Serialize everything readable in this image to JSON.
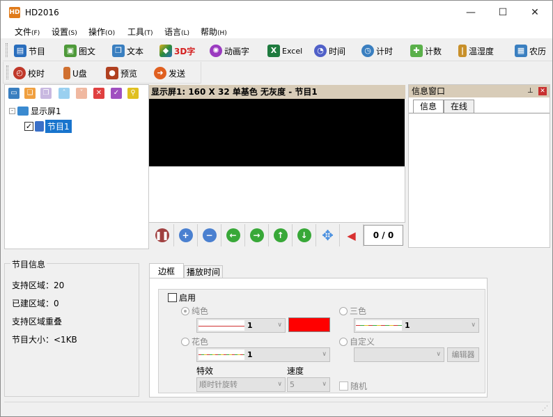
{
  "app": {
    "title": "HD2016",
    "icon_text": "HD"
  },
  "window_controls": {
    "minimize": "—",
    "maximize": "☐",
    "close": "✕"
  },
  "menu": [
    {
      "label": "文件",
      "key": "(F)"
    },
    {
      "label": "设置",
      "key": "(S)"
    },
    {
      "label": "操作",
      "key": "(O)"
    },
    {
      "label": "工具",
      "key": "(T)"
    },
    {
      "label": "语言",
      "key": "(L)"
    },
    {
      "label": "帮助",
      "key": "(H)"
    }
  ],
  "toolbar1": [
    {
      "label": "节目",
      "icon": "program-icon",
      "color": "#2a6ebd"
    },
    {
      "label": "图文",
      "icon": "image-text-icon",
      "color": "#4e9a3a"
    },
    {
      "label": "文本",
      "icon": "text-icon",
      "color": "#3a7fc0"
    },
    {
      "label": "3D字",
      "icon": "cube-3d-icon",
      "color": "#2a8c3a",
      "text_color": "#d42020"
    },
    {
      "label": "动画字",
      "icon": "animated-text-icon",
      "color": "#9a3ac0"
    },
    {
      "label": "Excel",
      "icon": "excel-icon",
      "color": "#1e7a3e"
    },
    {
      "label": "时间",
      "icon": "clock-icon",
      "color": "#5060c8"
    },
    {
      "label": "计时",
      "icon": "timer-icon",
      "color": "#3a7fc0"
    },
    {
      "label": "计数",
      "icon": "counter-icon",
      "color": "#5ab04a"
    },
    {
      "label": "温湿度",
      "icon": "thermometer-icon",
      "color": "#c8902a"
    },
    {
      "label": "农历",
      "icon": "calendar-icon",
      "color": "#3a7fc0"
    }
  ],
  "toolbar2": [
    {
      "label": "校时",
      "icon": "sync-clock-icon",
      "color": "#c0382a"
    },
    {
      "label": "U盘",
      "icon": "usb-drive-icon",
      "color": "#d07030"
    },
    {
      "label": "预览",
      "icon": "camera-icon",
      "color": "#b04020"
    },
    {
      "label": "发送",
      "icon": "send-arrow-icon",
      "color": "#e06020"
    }
  ],
  "tree": {
    "root": "显示屏1",
    "child": "节目1"
  },
  "screen": {
    "header": "显示屏1: 160 X 32  单基色 无灰度 - 节目1",
    "counter": "0 / 0"
  },
  "info_window": {
    "title": "信息窗口",
    "tabs": [
      "信息",
      "在线"
    ],
    "pin": "ᵖ",
    "close": "✕"
  },
  "program_info": {
    "title": "节目信息",
    "rows": [
      "支持区域：20",
      "已建区域：0",
      "支持区域重叠",
      "节目大小：<1KB"
    ]
  },
  "tabs": [
    "边框",
    "播放时间"
  ],
  "border_options": {
    "enable_label": "启用",
    "solid_label": "纯色",
    "tri_label": "三色",
    "flower_label": "花色",
    "custom_label": "自定义",
    "solid_width": "1",
    "tri_width": "1",
    "flower_width": "1",
    "editor_button": "编辑器",
    "effect_label": "特效",
    "effect_value": "顺时针旋转",
    "speed_label": "速度",
    "speed_value": "5",
    "random_label": "随机",
    "solid_color": "#ff0000"
  }
}
